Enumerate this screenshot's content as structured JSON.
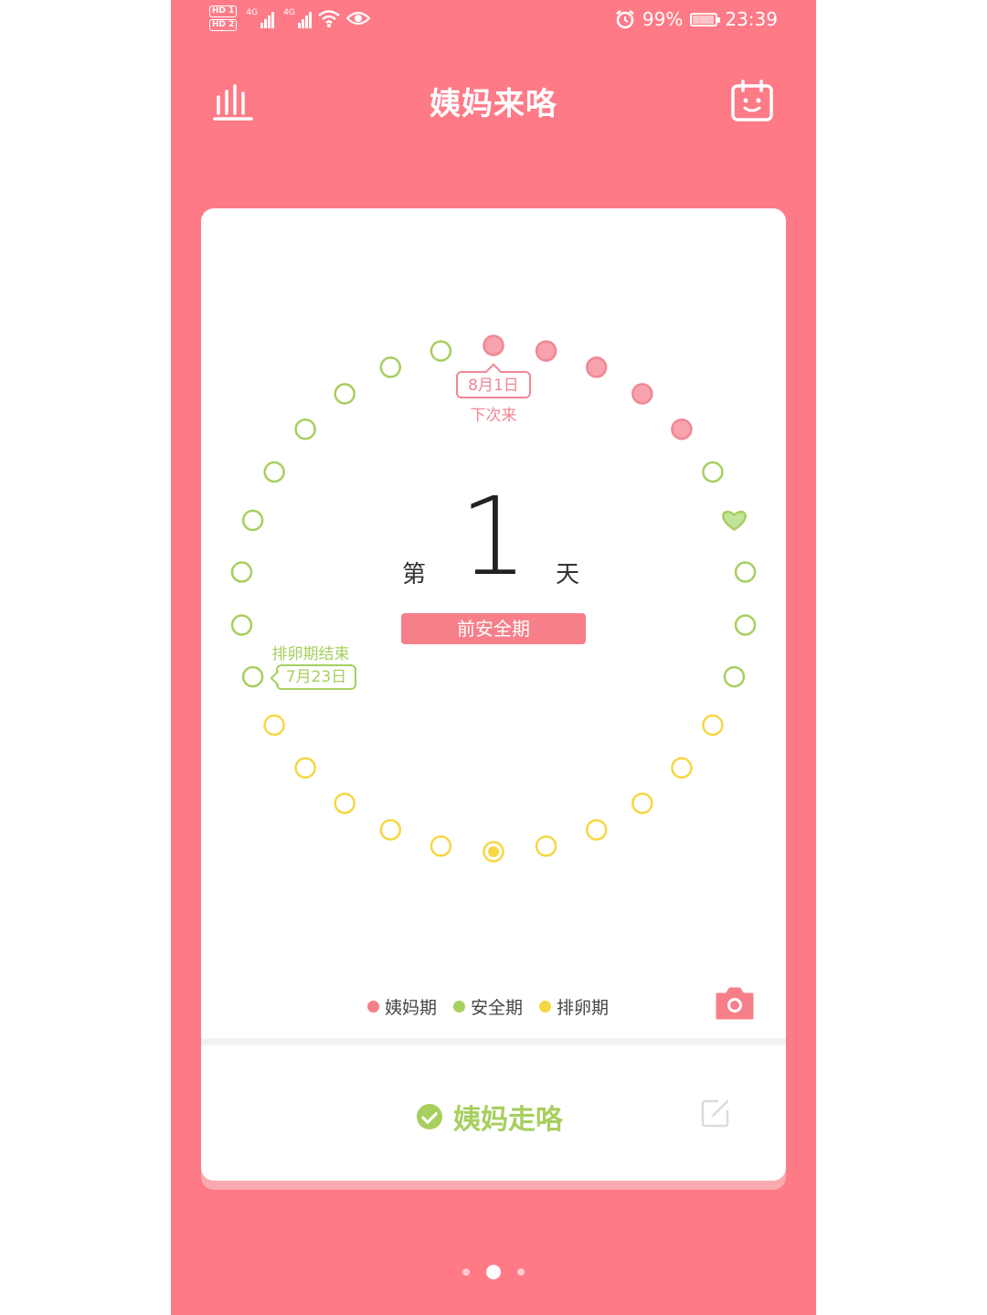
{
  "statusbar": {
    "sim1": "HD 1",
    "sim2": "HD 2",
    "network": "4G",
    "battery": "99%",
    "time": "23:39",
    "icons": [
      "signal-icon",
      "wifi-icon",
      "eye-icon",
      "alarm-icon",
      "battery-charging-icon"
    ]
  },
  "header": {
    "title": "姨妈来咯",
    "left_icon": "bar-chart-icon",
    "right_icon": "calendar-face-icon"
  },
  "cycle": {
    "prefix": "第",
    "day": "1",
    "suffix": "天",
    "phase": "前安全期",
    "next_period_date": "8月1日",
    "next_period_label": "下次来",
    "ovulation_end_label": "排卵期结束",
    "ovulation_end_date": "7月23日",
    "total_days": 30,
    "period_days": 5,
    "colors": {
      "period": "#f08795",
      "safe": "#a7cf5e",
      "ovulation": "#f6d742"
    }
  },
  "legend": [
    {
      "label": "姨妈期",
      "color": "#f67f89"
    },
    {
      "label": "安全期",
      "color": "#a7cf5e"
    },
    {
      "label": "排卵期",
      "color": "#f6d742"
    }
  ],
  "actions": {
    "period_end": "姨妈走咯",
    "camera_icon": "camera-icon",
    "edit_icon": "edit-icon"
  },
  "pager": {
    "pages": 3,
    "active": 1
  }
}
